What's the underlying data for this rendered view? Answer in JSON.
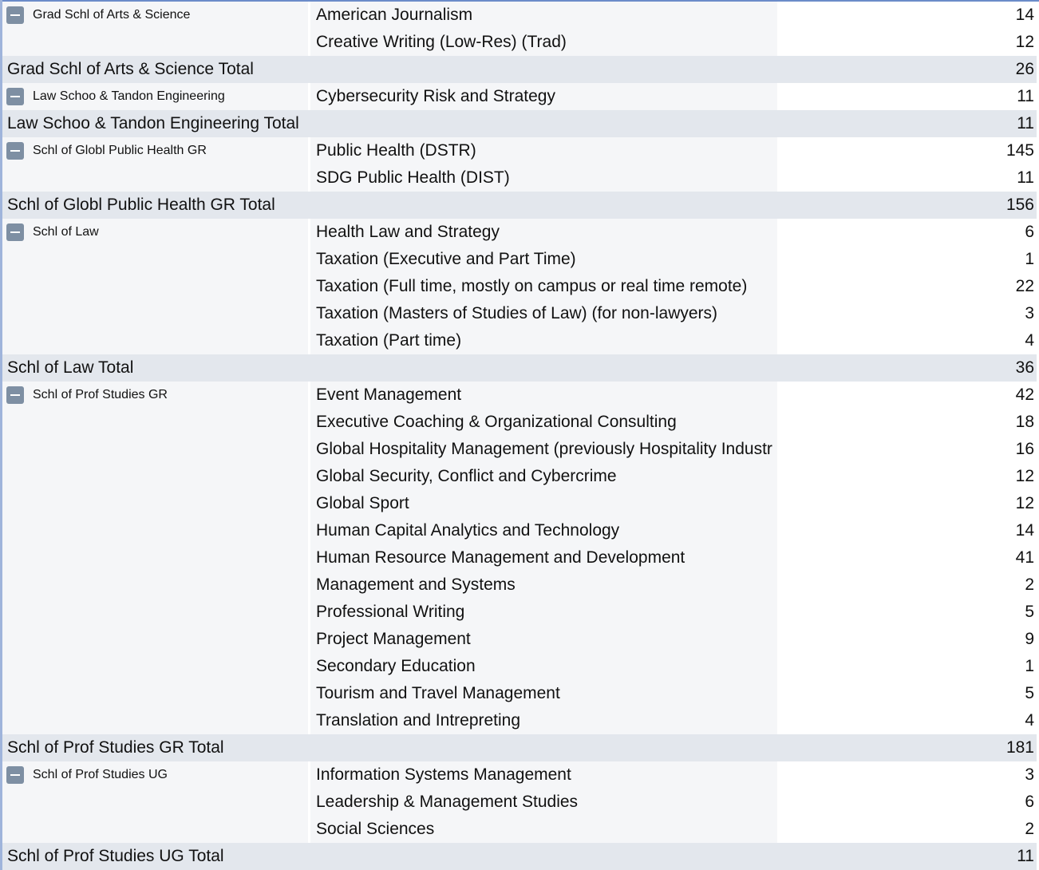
{
  "groups": [
    {
      "name": "Grad Schl of Arts & Science",
      "programs": [
        {
          "program": "American Journalism",
          "count": "14"
        },
        {
          "program": "Creative Writing (Low-Res) (Trad)",
          "count": "12"
        }
      ],
      "total_label": "Grad Schl of Arts & Science Total",
      "total": "26"
    },
    {
      "name": "Law Schoo & Tandon Engineering",
      "programs": [
        {
          "program": "Cybersecurity Risk and Strategy",
          "count": "11"
        }
      ],
      "total_label": "Law Schoo & Tandon Engineering Total",
      "total": "11"
    },
    {
      "name": "Schl of Globl Public Health GR",
      "programs": [
        {
          "program": "Public Health (DSTR)",
          "count": "145"
        },
        {
          "program": "SDG Public Health (DIST)",
          "count": "11"
        }
      ],
      "total_label": "Schl of Globl Public Health GR Total",
      "total": "156"
    },
    {
      "name": "Schl of Law",
      "programs": [
        {
          "program": "Health Law and Strategy",
          "count": "6"
        },
        {
          "program": "Taxation (Executive and Part Time)",
          "count": "1"
        },
        {
          "program": "Taxation (Full time, mostly on campus or real time remote)",
          "count": "22"
        },
        {
          "program": "Taxation (Masters of Studies of Law) (for non-lawyers)",
          "count": "3"
        },
        {
          "program": "Taxation (Part time)",
          "count": "4"
        }
      ],
      "total_label": "Schl of Law Total",
      "total": "36"
    },
    {
      "name": "Schl of Prof Studies GR",
      "programs": [
        {
          "program": "Event Management",
          "count": "42"
        },
        {
          "program": "Executive Coaching & Organizational Consulting",
          "count": "18"
        },
        {
          "program": "Global Hospitality Management (previously Hospitality Industr",
          "count": "16"
        },
        {
          "program": "Global Security, Conflict and Cybercrime",
          "count": "12"
        },
        {
          "program": "Global Sport",
          "count": "12"
        },
        {
          "program": "Human Capital Analytics and Technology",
          "count": "14"
        },
        {
          "program": "Human Resource Management and Development",
          "count": "41"
        },
        {
          "program": "Management and Systems",
          "count": "2"
        },
        {
          "program": "Professional Writing",
          "count": "5"
        },
        {
          "program": "Project Management",
          "count": "9"
        },
        {
          "program": "Secondary Education",
          "count": "1"
        },
        {
          "program": "Tourism and Travel Management",
          "count": "5"
        },
        {
          "program": "Translation and Intrepreting",
          "count": "4"
        }
      ],
      "total_label": "Schl of Prof Studies GR Total",
      "total": "181"
    },
    {
      "name": "Schl of Prof Studies UG",
      "programs": [
        {
          "program": "Information Systems Management",
          "count": "3"
        },
        {
          "program": "Leadership & Management Studies",
          "count": "6"
        },
        {
          "program": "Social Sciences",
          "count": "2"
        }
      ],
      "total_label": "Schl of Prof Studies UG Total",
      "total": "11"
    }
  ],
  "colors": {
    "total_row": "#e3e7ed",
    "label_cell": "#f5f6f8",
    "collapse_button": "#7e8fa3",
    "text": "#111111"
  },
  "icons": {
    "collapse": "minus-square-icon"
  }
}
